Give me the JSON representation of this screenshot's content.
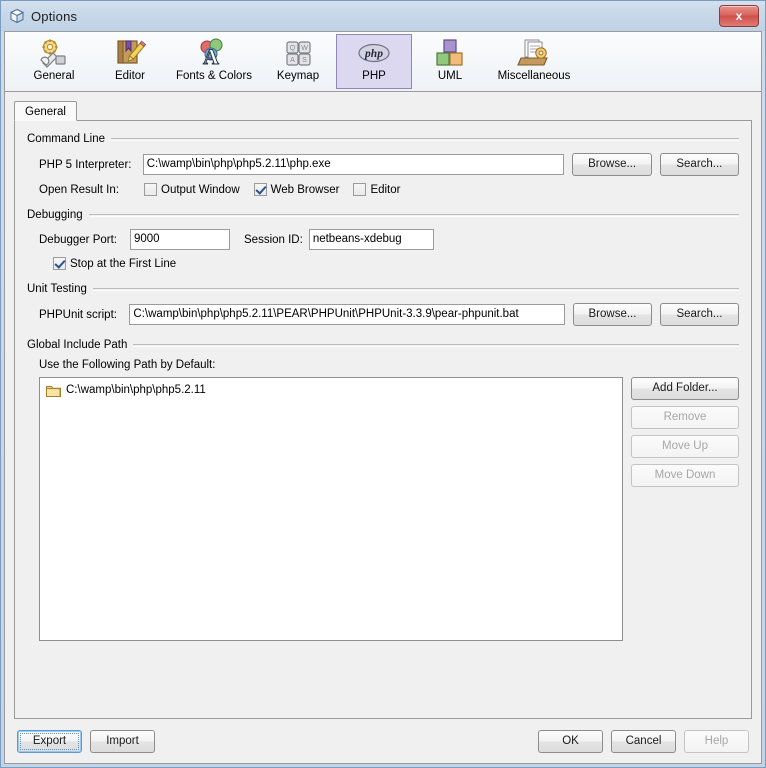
{
  "window": {
    "title": "Options",
    "icon": "cube-icon",
    "close_label": "x",
    "accent": "#dcd8ef",
    "border_color": "#7a9cc0"
  },
  "categories": [
    {
      "label": "General",
      "icon": "gear-wrench-icon",
      "selected": false
    },
    {
      "label": "Editor",
      "icon": "notebook-pencil-icon",
      "selected": false
    },
    {
      "label": "Fonts & Colors",
      "icon": "font-colors-icon",
      "selected": false
    },
    {
      "label": "Keymap",
      "icon": "keyboard-keys-icon",
      "selected": false
    },
    {
      "label": "PHP",
      "icon": "php-elephant-icon",
      "selected": true
    },
    {
      "label": "UML",
      "icon": "uml-blocks-icon",
      "selected": false
    },
    {
      "label": "Miscellaneous",
      "icon": "documents-gear-icon",
      "selected": false
    }
  ],
  "tabs": [
    {
      "label": "General",
      "selected": true
    }
  ],
  "command_line": {
    "title": "Command Line",
    "interpreter_label": "PHP 5 Interpreter:",
    "interpreter_value": "C:\\wamp\\bin\\php\\php5.2.11\\php.exe",
    "browse_label": "Browse...",
    "search_label": "Search...",
    "open_result_label": "Open Result In:",
    "options": [
      {
        "label": "Output Window",
        "checked": false
      },
      {
        "label": "Web Browser",
        "checked": true
      },
      {
        "label": "Editor",
        "checked": false
      }
    ]
  },
  "debugging": {
    "title": "Debugging",
    "port_label": "Debugger Port:",
    "port_value": "9000",
    "session_label": "Session ID:",
    "session_value": "netbeans-xdebug",
    "stop_first_line_label": "Stop at the First Line",
    "stop_first_line_checked": true
  },
  "unit_testing": {
    "title": "Unit Testing",
    "script_label": "PHPUnit script:",
    "script_value": "C:\\wamp\\bin\\php\\php5.2.11\\PEAR\\PHPUnit\\PHPUnit-3.3.9\\pear-phpunit.bat",
    "browse_label": "Browse...",
    "search_label": "Search..."
  },
  "global_include_path": {
    "title": "Global Include Path",
    "subtitle": "Use the Following Path by Default:",
    "items": [
      {
        "label": "C:\\wamp\\bin\\php\\php5.2.11",
        "icon": "folder-icon"
      }
    ],
    "buttons": [
      {
        "label": "Add Folder...",
        "enabled": true
      },
      {
        "label": "Remove",
        "enabled": false
      },
      {
        "label": "Move Up",
        "enabled": false
      },
      {
        "label": "Move Down",
        "enabled": false
      }
    ]
  },
  "footer": {
    "export_label": "Export",
    "import_label": "Import",
    "ok_label": "OK",
    "cancel_label": "Cancel",
    "help_label": "Help",
    "help_enabled": false
  }
}
